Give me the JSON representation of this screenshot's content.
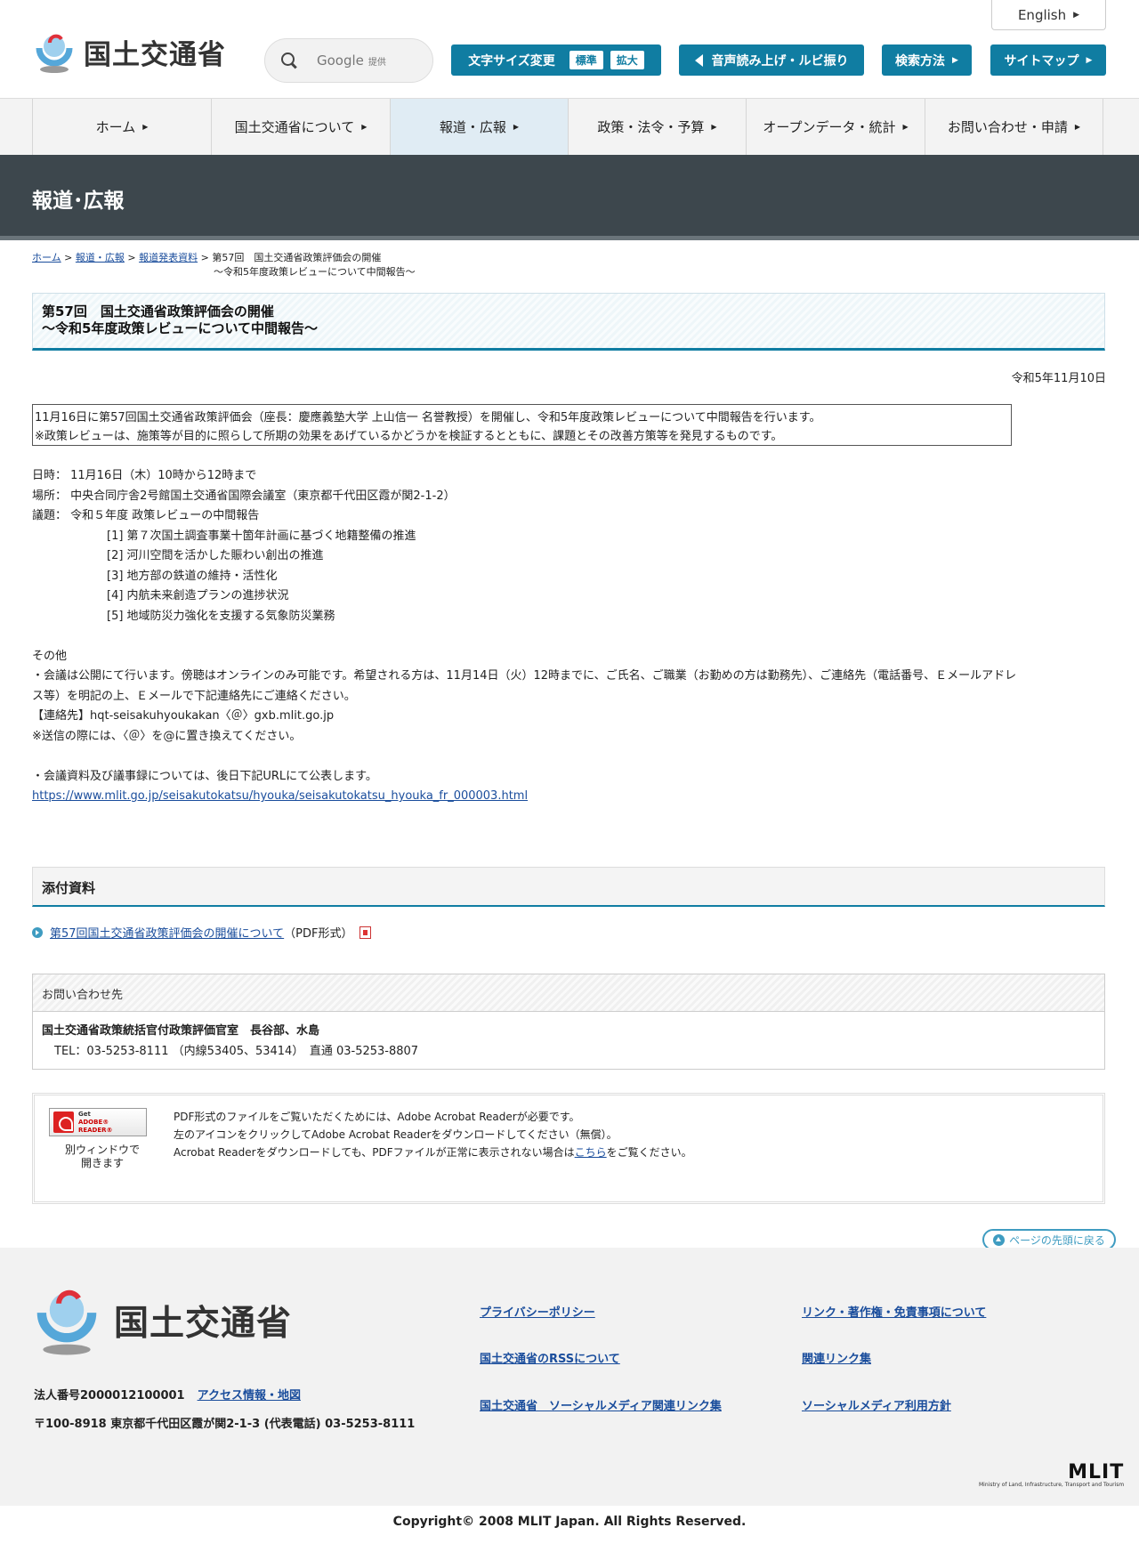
{
  "header": {
    "logo_text": "国土交通省",
    "english": "English",
    "search_provider": "Google",
    "search_provider_note": "提供",
    "font_size_label": "文字サイズ変更",
    "font_standard": "標準",
    "font_large": "拡大",
    "read_aloud": "音声読み上げ・ルビ振り",
    "search_method": "検索方法",
    "sitemap": "サイトマップ",
    "accent_color": "#107da2"
  },
  "nav": [
    {
      "label": "ホーム"
    },
    {
      "label": "国土交通省について"
    },
    {
      "label": "報道・広報"
    },
    {
      "label": "政策・法令・予算"
    },
    {
      "label": "オープンデータ・統計"
    },
    {
      "label": "お問い合わせ・申請"
    }
  ],
  "banner_title": "報道･広報",
  "breadcrumb": {
    "home": "ホーム",
    "press": "報道・広報",
    "releases": "報道発表資料",
    "current_line1": "第57回　国土交通省政策評価会の開催",
    "current_line2": "～令和5年度政策レビューについて中間報告～"
  },
  "article": {
    "title_line1": "第57回　国土交通省政策評価会の開催",
    "title_line2": "～令和5年度政策レビューについて中間報告～",
    "date": "令和5年11月10日",
    "summary_line1": "11月16日に第57回国土交通省政策評価会（座長：慶應義塾大学 上山信一 名誉教授）を開催し、令和5年度政策レビューについて中間報告を行います。",
    "summary_line2": "※政策レビューは、施策等が目的に照らして所期の効果をあげているかどうかを検証するとともに、課題とその改善方策等を発見するものです。",
    "datetime": "日時：  11月16日（木）10時から12時まで",
    "place": "場所：  中央合同庁舎2号館国土交通省国際会議室（東京都千代田区霞が関2-1-2）",
    "agenda": "議題：  令和５年度 政策レビューの中間報告",
    "agenda_items": [
      "[1] 第７次国土調査事業十箇年計画に基づく地籍整備の推進",
      "[2] 河川空間を活かした賑わい創出の推進",
      "[3] 地方部の鉄道の維持・活性化",
      "[4] 内航未来創造プランの進捗状況",
      "[5] 地域防災力強化を支援する気象防災業務"
    ],
    "other_heading": "その他",
    "other_line1": "・会議は公開にて行います。傍聴はオンラインのみ可能です。希望される方は、11月14日（火）12時までに、ご氏名、ご職業（お勤めの方は勤務先）、ご連絡先（電話番号、Ｅメールアドレ",
    "other_line2": "ス等）を明記の上、Ｅメールで下記連絡先にご連絡ください。",
    "contact_mail": "【連絡先】hqt-seisakuhyoukakan〈＠〉gxb.mlit.go.jp",
    "mail_note": "※送信の際には、〈＠〉を@に置き換えてください。",
    "publish_note": "・会議資料及び議事録については、後日下記URLにて公表します。",
    "url": "https://www.mlit.go.jp/seisakutokatsu/hyouka/seisakutokatsu_hyouka_fr_000003.html"
  },
  "attachments": {
    "heading": "添付資料",
    "items": [
      {
        "label": "第57回国土交通省政策評価会の開催について",
        "format": "（PDF形式）"
      }
    ]
  },
  "contact": {
    "heading": "お問い合わせ先",
    "name": "国土交通省政策統括官付政策評価官室　長谷部、水島",
    "tel": "TEL：03-5253-8111 （内線53405、53414）　直通 03-5253-8807"
  },
  "acrobat": {
    "badge_line1": "Get",
    "badge_line2": "ADOBE® READER®",
    "window_line1": "別ウィンドウで",
    "window_line2": "開きます",
    "text_line1": "PDF形式のファイルをご覧いただくためには、Adobe Acrobat Readerが必要です。",
    "text_line2": "左のアイコンをクリックしてAdobe Acrobat Readerをダウンロードしてください（無償）。",
    "text_line3_pre": "Acrobat Readerをダウンロードしても、PDFファイルが正常に表示されない場合は",
    "text_line3_link": "こちら",
    "text_line3_post": "をご覧ください。"
  },
  "to_top": "ページの先頭に戻る",
  "footer": {
    "logo_text": "国土交通省",
    "corp_number": "法人番号2000012100001",
    "access": "アクセス情報・地図",
    "address": "〒100-8918 東京都千代田区霞が関2-1-3 (代表電話) 03-5253-8111",
    "links_left": [
      "プライバシーポリシー",
      "国土交通省のRSSについて",
      "国土交通省　ソーシャルメディア関連リンク集"
    ],
    "links_right": [
      "リンク・著作権・免責事項について",
      "関連リンク集",
      "ソーシャルメディア利用方針"
    ],
    "mlit": "MLIT",
    "mlit_sub": "Ministry of Land, Infrastructure, Transport and Tourism",
    "copyright": "Copyright© 2008 MLIT Japan. All Rights Reserved."
  }
}
